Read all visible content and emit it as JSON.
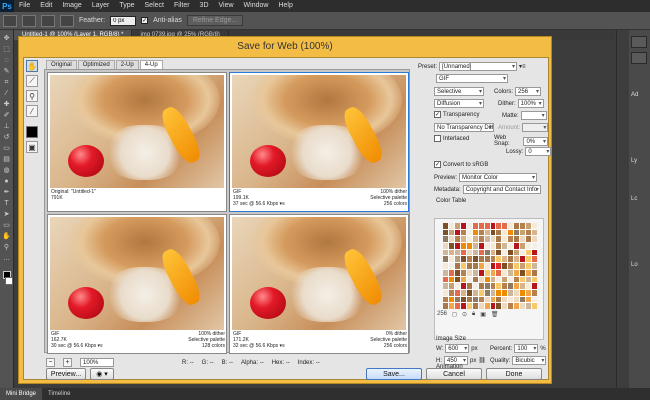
{
  "app": {
    "logo": "Ps"
  },
  "menu": [
    "File",
    "Edit",
    "Image",
    "Layer",
    "Type",
    "Select",
    "Filter",
    "3D",
    "View",
    "Window",
    "Help"
  ],
  "options_bar": {
    "feather_label": "Feather:",
    "feather_value": "0 px",
    "antialias_label": "Anti-alias",
    "antialias_checked": "✓",
    "refine_label": "Refine Edge..."
  },
  "doc_tabs": [
    "Untitled-1 @ 100% (Layer 1, RGB/8) *",
    "img 0739.jpg @ 25% (RGB/8)"
  ],
  "dialog": {
    "title": "Save for Web (100%)",
    "view_tabs": [
      "Original",
      "Optimized",
      "2-Up",
      "4-Up"
    ],
    "active_view_tab": "4-Up",
    "panes": [
      {
        "l1": "Original: \"Untitled-1\"",
        "l2": "791K",
        "l3": "",
        "r1": "",
        "r2": "",
        "r3": ""
      },
      {
        "l1": "GIF",
        "l2": "199.1K",
        "l3": "37 sec @ 56.6 Kbps  ▾≡",
        "r1": "100% dither",
        "r2": "Selective palette",
        "r3": "256 colors"
      },
      {
        "l1": "GIF",
        "l2": "162.7K",
        "l3": "30 sec @ 56.6 Kbps  ▾≡",
        "r1": "100% dither",
        "r2": "Selective palette",
        "r3": "128 colors"
      },
      {
        "l1": "GIF",
        "l2": "171.2K",
        "l3": "32 sec @ 56.6 Kbps  ▾≡",
        "r1": "0% dither",
        "r2": "Selective palette",
        "r3": "256 colors"
      }
    ],
    "zoom_value": "100%",
    "readouts": {
      "r": "R: --",
      "g": "G: --",
      "b": "B: --",
      "alpha": "Alpha: --",
      "hex": "Hex: --",
      "index": "Index: --"
    },
    "settings": {
      "preset_label": "Preset:",
      "preset_value": "[Unnamed]",
      "format": "GIF",
      "reduction": "Selective",
      "colors_label": "Colors:",
      "colors_value": "256",
      "dither_algo": "Diffusion",
      "dither_label": "Dither:",
      "dither_value": "100%",
      "transparency_label": "Transparency",
      "matte_label": "Matte:",
      "trans_dither": "No Transparency Dither",
      "amount_label": "Amount:",
      "interlaced_label": "Interlaced",
      "websnap_label": "Web Snap:",
      "websnap_value": "0%",
      "lossy_label": "Lossy:",
      "lossy_value": "0",
      "convert_label": "Convert to sRGB",
      "preview_label": "Preview:",
      "preview_value": "Monitor Color",
      "metadata_label": "Metadata:",
      "metadata_value": "Copyright and Contact Info",
      "color_table_label": "Color Table",
      "color_count": "256",
      "image_size_label": "Image Size",
      "w_label": "W:",
      "w_value": "600",
      "h_label": "H:",
      "h_value": "450",
      "px": "px",
      "percent_label": "Percent:",
      "percent_value": "100",
      "pct_sign": "%",
      "quality_label": "Quality:",
      "quality_value": "Bicubic",
      "animation_label": "Animation",
      "looping_label": "Looping Options:",
      "looping_value": "Once",
      "frame_counter": "1 of 1"
    },
    "buttons": {
      "preview": "Preview...",
      "save": "Save...",
      "cancel": "Cancel",
      "done": "Done"
    }
  },
  "right_dock": {
    "labels": [
      "Ad",
      "Ly",
      "Lc",
      "Lo"
    ]
  },
  "status_tabs": [
    "Mini Bridge",
    "Timeline"
  ]
}
